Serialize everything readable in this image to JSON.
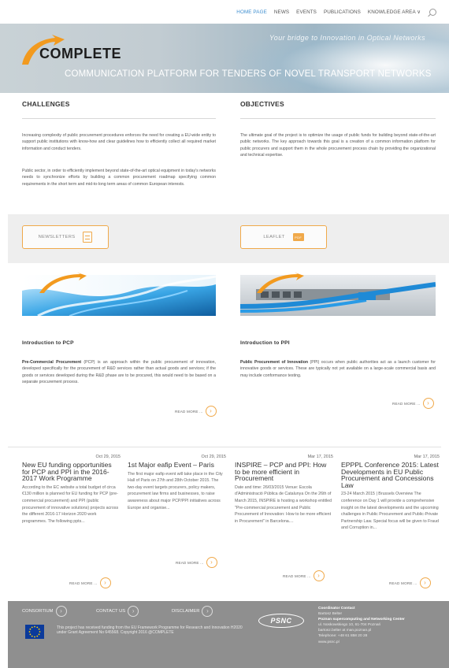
{
  "nav": {
    "items": [
      "HOME PAGE",
      "NEWS",
      "EVENTS",
      "PUBLICATIONS",
      "KNOWLEDGE AREA ∨"
    ],
    "active_index": 0
  },
  "banner": {
    "tagline": "Your bridge to Innovation in Optical Networks",
    "logo_text": "COMPLETE",
    "subtitle": "COMMUNICATION PLATFORM FOR TENDERS OF NOVEL TRANSPORT NETWORKS"
  },
  "challenges": {
    "heading": "CHALLENGES",
    "paragraphs": [
      "Increasing complexity of public procurement procedures enforces the need for creating a EU-wide entity to support public institutions with know-how and clear guidelines how to efficiently collect all required market information and conduct tenders.",
      "Public sector, in order to efficiently implement beyond state-of-the-art optical equipment in today's networks needs to synchronize efforts by building a common procurement roadmap specifying common requirements in the short term and mid-to-long term areas of common European interests."
    ]
  },
  "objectives": {
    "heading": "OBJECTIVES",
    "paragraphs": [
      "The ultimate goal of the project is to optimize the usage of public funds for building beyond state-of-the-art public networks. The key approach towards this goal is a creation of a common information platform for public procurers and support them in the whole procurement process chain by providing the organizational and technical expertise."
    ]
  },
  "buttons": {
    "newsletters": "NEWSLETTERS",
    "leaflet": "LEAFLET",
    "pdf_badge": "PDF"
  },
  "intro_pcp": {
    "heading": "Introduction to PCP",
    "lead": "Pre-Commercial Procurement",
    "body": " (PCP) is an approach within the public procurement of innovation, developed specifically for the procurement of R&D services rather than actual goods and services; if the goods or services developed during the R&D phase are to be procured, this would need to be based on a separate procurement process.",
    "read_more": "READ MORE ..."
  },
  "intro_ppi": {
    "heading": "Introduction to PPI",
    "lead": "Public Procurement of Innovation",
    "body": " (PPI) occurs when public authorities act as a launch customer for innovative goods or services. These are typically not yet available on a large-scale commercial basis and may include conformance testing.",
    "read_more": "READ MORE ..."
  },
  "news": [
    {
      "date": "Oct 29, 2015",
      "title": "New EU funding opportunities for PCP and PPI in the 2016-2017 Work Programme",
      "body": "According to the EC website a total budget of circa €130 million is planned for EU funding for PCP (pre-commercial procurement) and PPI (public procurement of innovative solutions) projects across the different 2016-17 Horizon 2020 work programmes. The following ppts...",
      "read_more": "READ MORE ..."
    },
    {
      "date": "Oct 29, 2015",
      "title": "1st Major eafip Event – Paris",
      "body": "The first major eafip event will take place in the City Hall of Paris on 27th and 28th October 2015. The two-day event targets procurers, policy makers, procurement law firms and businesses, to raise awareness about major PCP/PPI initiatives across Europe and organise...",
      "read_more": "READ MORE ..."
    },
    {
      "date": "Mar 17, 2015",
      "title": "INSPIRE – PCP and PPI: How to be more efficient in Procurement",
      "body": "Date and time: 26/03/2015 Venue: Escola d'Administració Pública de Catalunya On the 26th of March 2015, INSPIRE is hosting a workshop entitled \"Pre-commercial procurement and Public Procurement of Innovation: How to be more efficient in Procurement\" in Barcelona....",
      "read_more": "READ MORE ..."
    },
    {
      "date": "Mar 17, 2015",
      "title": "EPPPL Conference 2015: Latest Developments in EU Public Procurement and Concessions Law",
      "body": "23-24 March 2015 | Brussels Overview The conference on Day 1 will provide a comprehensive insight on the latest developments and the upcoming challenges in Public Procurement and Public-Private Partnership Law. Special focus will be given to Fraud and Corruption in...",
      "read_more": "READ MORE ..."
    }
  ],
  "footer": {
    "links": [
      "CONSORTIUM",
      "CONTACT US",
      "DISCLAIMER"
    ],
    "funding": "This project has received funding from the EU Framework Programme for Research and Innovation H2020 under Grant Agreement No 645568. Copyright 2016 @COMPLETE",
    "psnc": "PSNC",
    "contact": {
      "title": "Coordinator Contact",
      "name": "Bartosz Belter",
      "org": "Poznan supercomputing and Networking Center",
      "address": "ul. Noskowskiego 10, 61-704 Poznań",
      "email": "bartosz.belter at man.poznan.pl",
      "phone": "Telephone: +48 61 858 20 28",
      "web": "www.psnc.pl"
    }
  },
  "colors": {
    "accent": "#f0a94a",
    "nav_active": "#3f8fd0",
    "footer_bg": "#8f8f8f",
    "band_bg": "#eeeeee"
  }
}
